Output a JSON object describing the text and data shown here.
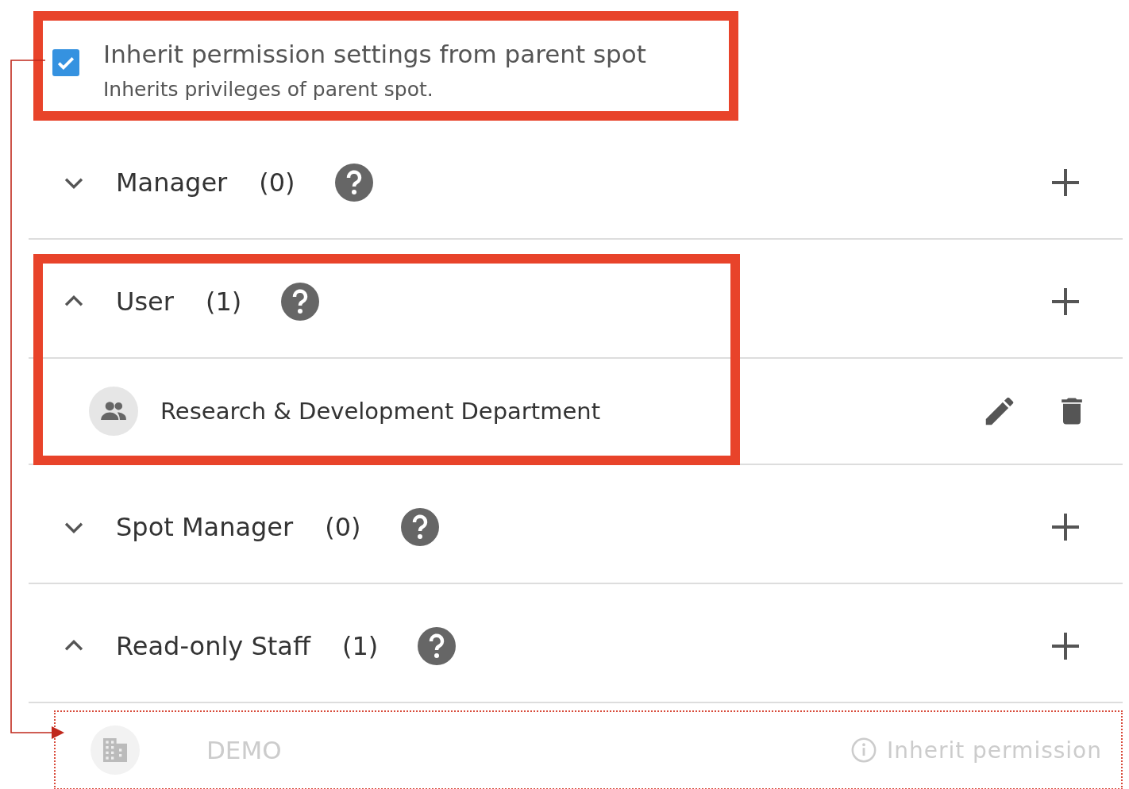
{
  "inherit": {
    "label": "Inherit permission settings from parent spot",
    "description": "Inherits privileges of parent spot.",
    "checked": true
  },
  "roles": [
    {
      "name": "Manager",
      "count": "(0)",
      "expanded": false,
      "highlighted": false
    },
    {
      "name": "User",
      "count": "(1)",
      "expanded": true,
      "highlighted": true,
      "members": [
        {
          "kind": "group",
          "name": "Research & Development Department"
        }
      ]
    },
    {
      "name": "Spot Manager",
      "count": "(0)",
      "expanded": false,
      "highlighted": false
    },
    {
      "name": "Read-only Staff",
      "count": "(1)",
      "expanded": true,
      "highlighted": false,
      "members": [
        {
          "kind": "inherited",
          "name": "DEMO",
          "note": "Inherit permission"
        }
      ]
    }
  ]
}
